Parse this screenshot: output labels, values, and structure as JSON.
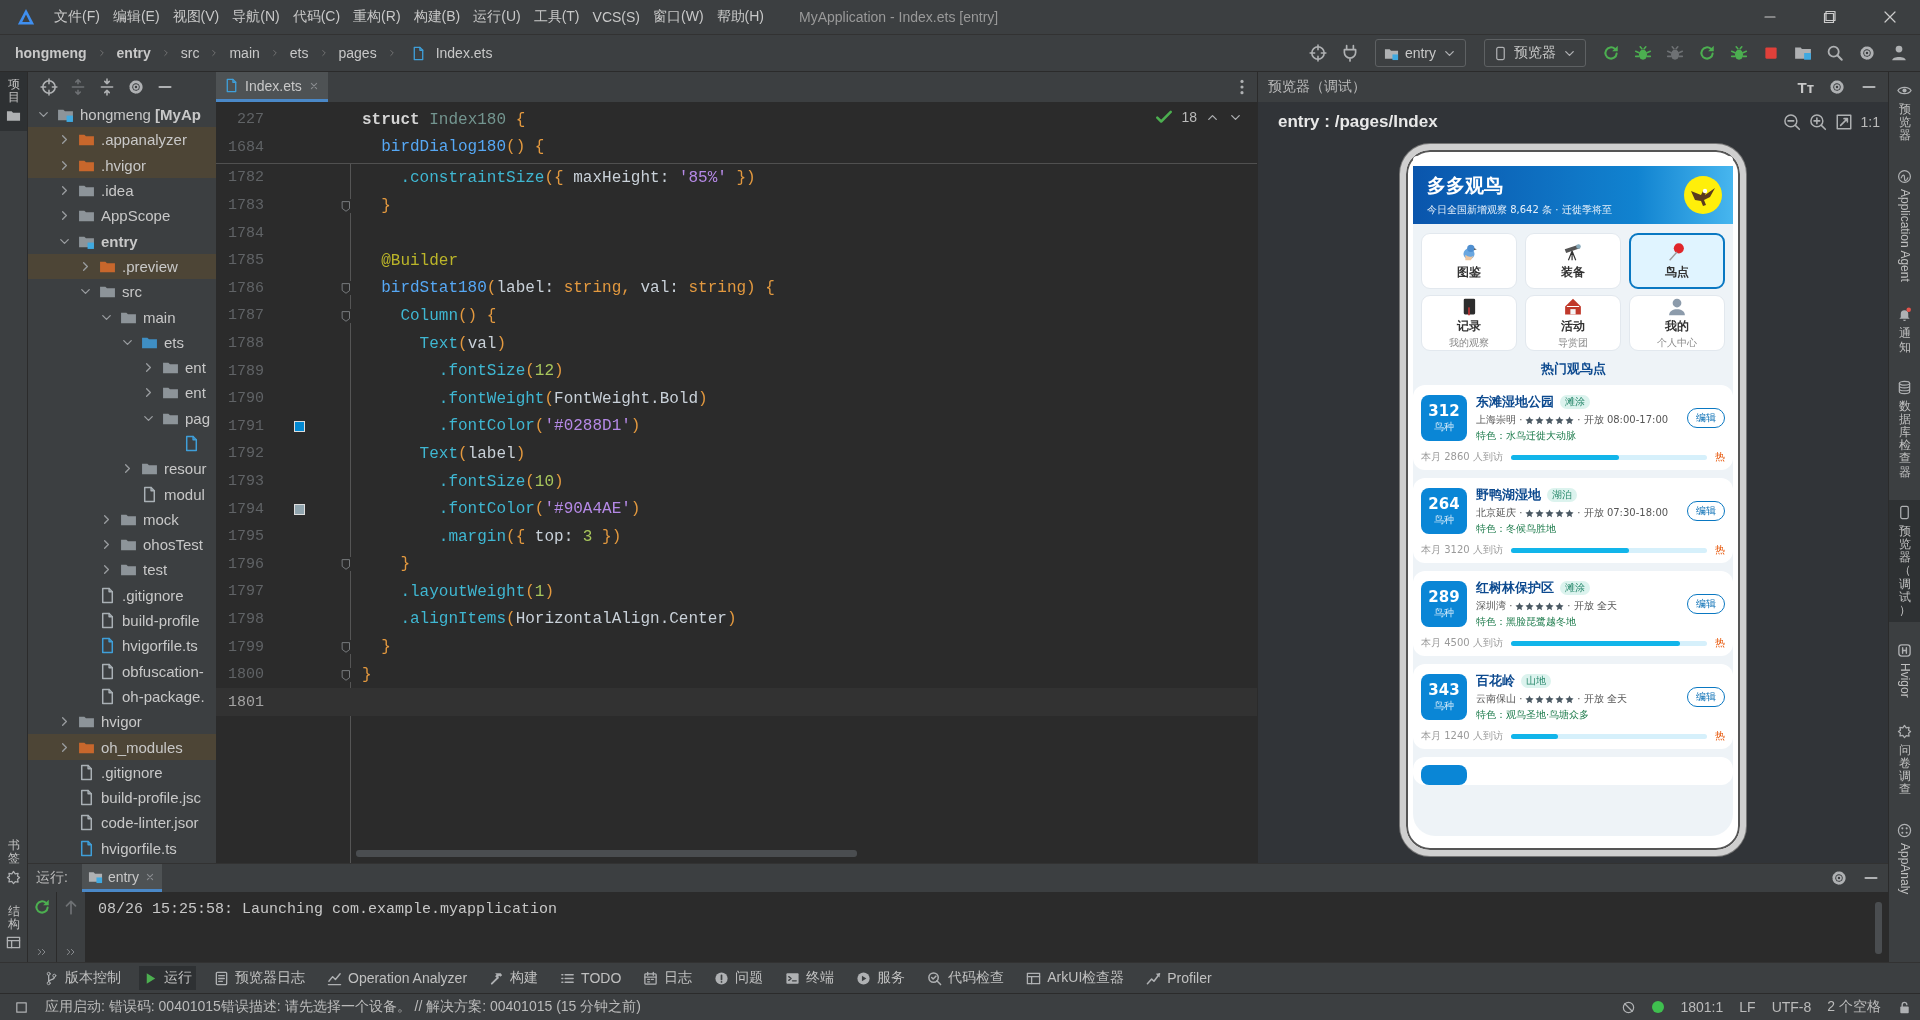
{
  "title_bar": {
    "menus": [
      "文件(F)",
      "编辑(E)",
      "视图(V)",
      "导航(N)",
      "代码(C)",
      "重构(R)",
      "构建(B)",
      "运行(U)",
      "工具(T)",
      "VCS(S)",
      "窗口(W)",
      "帮助(H)"
    ],
    "title": "MyApplication - Index.ets [entry]"
  },
  "nav_bar": {
    "breadcrumb": [
      "hongmeng",
      "entry",
      "src",
      "main",
      "ets",
      "pages",
      "Index.ets"
    ],
    "run_config": "entry",
    "device": "预览器"
  },
  "left_stripe": {
    "top": {
      "label": "项目",
      "selected": true
    },
    "bottom": [
      "书签",
      "结构"
    ]
  },
  "project_tree": [
    {
      "name": "hongmeng **[MyAp**",
      "kind": "module",
      "expanded": true,
      "children": [
        {
          "name": ".appanalyzer",
          "kind": "excluded",
          "expanded": false
        },
        {
          "name": ".hvigor",
          "kind": "excluded",
          "expanded": false
        },
        {
          "name": ".idea",
          "kind": "folder",
          "expanded": false
        },
        {
          "name": "AppScope",
          "kind": "folder",
          "expanded": false
        },
        {
          "name": "**entry**",
          "kind": "module",
          "expanded": true,
          "children": [
            {
              "name": ".preview",
              "kind": "excluded",
              "expanded": false
            },
            {
              "name": "src",
              "kind": "folder",
              "expanded": true,
              "children": [
                {
                  "name": "main",
                  "kind": "folder",
                  "expanded": true,
                  "children": [
                    {
                      "name": "ets",
                      "kind": "source",
                      "expanded": true,
                      "children": [
                        {
                          "name": "ent",
                          "kind": "folder",
                          "expanded": false
                        },
                        {
                          "name": "ent",
                          "kind": "folder",
                          "expanded": false
                        },
                        {
                          "name": "pag",
                          "kind": "folder",
                          "expanded": true,
                          "children": [
                            {
                              "kind": "ets"
                            }
                          ]
                        }
                      ]
                    },
                    {
                      "name": "resour",
                      "kind": "folder",
                      "expanded": false
                    },
                    {
                      "name": "modul",
                      "kind": "config"
                    }
                  ]
                },
                {
                  "name": "mock",
                  "kind": "folder",
                  "expanded": false
                },
                {
                  "name": "ohosTest",
                  "kind": "folder",
                  "expanded": false
                },
                {
                  "name": "test",
                  "kind": "folder",
                  "expanded": false
                }
              ]
            },
            {
              "name": ".gitignore",
              "kind": "file"
            },
            {
              "name": "build-profile",
              "kind": "config"
            },
            {
              "name": "hvigorfile.ts",
              "kind": "ts"
            },
            {
              "name": "obfuscation-",
              "kind": "file"
            },
            {
              "name": "oh-package.",
              "kind": "config"
            }
          ]
        },
        {
          "name": "hvigor",
          "kind": "folder",
          "expanded": false
        },
        {
          "name": "oh_modules",
          "kind": "excluded",
          "expanded": false
        },
        {
          "name": ".gitignore",
          "kind": "file"
        },
        {
          "name": "build-profile.jsc",
          "kind": "config"
        },
        {
          "name": "code-linter.jsor",
          "kind": "config"
        },
        {
          "name": "hvigorfile.ts",
          "kind": "ts"
        }
      ]
    }
  ],
  "editor": {
    "tab": {
      "label": "Index.ets",
      "selected": true
    },
    "inspection_count": "18",
    "sticky_lines": [
      {
        "number": "227",
        "tokens": [
          {
            "kind": "kw",
            "text": "struct "
          },
          {
            "kind": "type",
            "text": "Index180 "
          },
          {
            "kind": "punct",
            "text": "{"
          }
        ]
      },
      {
        "number": "1684",
        "tokens": [
          {
            "kind": "fn",
            "text": "  birdDialog180"
          },
          {
            "kind": "punct",
            "text": "() {"
          }
        ]
      }
    ],
    "lines": [
      {
        "number": "1782",
        "current": false,
        "fold": false,
        "tokens": [
          {
            "kind": "method",
            "text": "    .constraintSize"
          },
          {
            "kind": "punct",
            "text": "({"
          },
          {
            "kind": "plain",
            "text": " maxHeight: "
          },
          {
            "kind": "str",
            "text": "'85%'"
          },
          {
            "kind": "punct",
            "text": " })"
          }
        ]
      },
      {
        "number": "1783",
        "current": false,
        "fold": true,
        "tokens": [
          {
            "kind": "punct",
            "text": "  }"
          }
        ]
      },
      {
        "number": "1784",
        "current": false,
        "fold": false
      },
      {
        "number": "1785",
        "current": false,
        "fold": false,
        "tokens": [
          {
            "kind": "deco",
            "text": "  @Builder"
          }
        ]
      },
      {
        "number": "1786",
        "current": false,
        "fold": true,
        "tokens": [
          {
            "kind": "fn",
            "text": "  birdStat180"
          },
          {
            "kind": "punct",
            "text": "("
          },
          {
            "kind": "plain",
            "text": "label: "
          },
          {
            "kind": "ty",
            "text": "string"
          },
          {
            "kind": "punct",
            "text": ","
          },
          {
            "kind": "plain",
            "text": " val: "
          },
          {
            "kind": "ty",
            "text": "string"
          },
          {
            "kind": "punct",
            "text": ") {"
          }
        ]
      },
      {
        "number": "1787",
        "current": false,
        "fold": true,
        "tokens": [
          {
            "kind": "comp",
            "text": "    Column"
          },
          {
            "kind": "punct",
            "text": "() {"
          }
        ]
      },
      {
        "number": "1788",
        "current": false,
        "fold": false,
        "tokens": [
          {
            "kind": "comp",
            "text": "      Text"
          },
          {
            "kind": "punct",
            "text": "("
          },
          {
            "kind": "plain",
            "text": "val"
          },
          {
            "kind": "punct",
            "text": ")"
          }
        ]
      },
      {
        "number": "1789",
        "current": false,
        "fold": false,
        "tokens": [
          {
            "kind": "method",
            "text": "        .fontSize"
          },
          {
            "kind": "punct",
            "text": "("
          },
          {
            "kind": "num",
            "text": "12"
          },
          {
            "kind": "punct",
            "text": ")"
          }
        ]
      },
      {
        "number": "1790",
        "current": false,
        "fold": false,
        "tokens": [
          {
            "kind": "method",
            "text": "        .fontWeight"
          },
          {
            "kind": "punct",
            "text": "("
          },
          {
            "kind": "plain",
            "text": "FontWeight.Bold"
          },
          {
            "kind": "punct",
            "text": ")"
          }
        ]
      },
      {
        "number": "1791",
        "current": false,
        "fold": false,
        "color": "#0288d1",
        "tokens": [
          {
            "kind": "method",
            "text": "        .fontColor"
          },
          {
            "kind": "punct",
            "text": "("
          },
          {
            "kind": "str",
            "text": "'#0288D1'"
          },
          {
            "kind": "punct",
            "text": ")"
          }
        ]
      },
      {
        "number": "1792",
        "current": false,
        "fold": false,
        "tokens": [
          {
            "kind": "comp",
            "text": "      Text"
          },
          {
            "kind": "punct",
            "text": "("
          },
          {
            "kind": "plain",
            "text": "label"
          },
          {
            "kind": "punct",
            "text": ")"
          }
        ]
      },
      {
        "number": "1793",
        "current": false,
        "fold": false,
        "tokens": [
          {
            "kind": "method",
            "text": "        .fontSize"
          },
          {
            "kind": "punct",
            "text": "("
          },
          {
            "kind": "num",
            "text": "10"
          },
          {
            "kind": "punct",
            "text": ")"
          }
        ]
      },
      {
        "number": "1794",
        "current": false,
        "fold": false,
        "color": "#90a4ae",
        "tokens": [
          {
            "kind": "method",
            "text": "        .fontColor"
          },
          {
            "kind": "punct",
            "text": "("
          },
          {
            "kind": "str",
            "text": "'#90A4AE'"
          },
          {
            "kind": "punct",
            "text": ")"
          }
        ]
      },
      {
        "number": "1795",
        "current": false,
        "fold": false,
        "tokens": [
          {
            "kind": "method",
            "text": "        .margin"
          },
          {
            "kind": "punct",
            "text": "({"
          },
          {
            "kind": "plain",
            "text": " top: "
          },
          {
            "kind": "num",
            "text": "3"
          },
          {
            "kind": "punct",
            "text": " })"
          }
        ]
      },
      {
        "number": "1796",
        "current": false,
        "fold": true,
        "tokens": [
          {
            "kind": "punct",
            "text": "    }"
          }
        ]
      },
      {
        "number": "1797",
        "current": false,
        "fold": false,
        "tokens": [
          {
            "kind": "method",
            "text": "    .layoutWeight"
          },
          {
            "kind": "punct",
            "text": "("
          },
          {
            "kind": "num",
            "text": "1"
          },
          {
            "kind": "punct",
            "text": ")"
          }
        ]
      },
      {
        "number": "1798",
        "current": false,
        "fold": false,
        "tokens": [
          {
            "kind": "method",
            "text": "    .alignItems"
          },
          {
            "kind": "punct",
            "text": "("
          },
          {
            "kind": "plain",
            "text": "HorizontalAlign.Center"
          },
          {
            "kind": "punct",
            "text": ")"
          }
        ]
      },
      {
        "number": "1799",
        "current": false,
        "fold": true,
        "tokens": [
          {
            "kind": "punct",
            "text": "  }"
          }
        ]
      },
      {
        "number": "1800",
        "current": false,
        "fold": true,
        "tokens": [
          {
            "kind": "punct",
            "text": "}"
          }
        ]
      },
      {
        "number": "1801",
        "current": true,
        "fold": false
      }
    ]
  },
  "preview": {
    "title": "预览器（调试）",
    "font_icon": "Tт",
    "route": "entry : /pages/Index",
    "zoom_label": "1:1",
    "app": {
      "title": "多多观鸟",
      "subtitle": "今日全国新增观察 8,642 条 · 迁徙季将至",
      "tiles": [
        {
          "title": "图鉴",
          "selected": false
        },
        {
          "title": "装备",
          "selected": false
        },
        {
          "title": "鸟点",
          "selected": true
        },
        {
          "title": "记录",
          "subtitle": "我的观察",
          "selected": false
        },
        {
          "title": "活动",
          "subtitle": "导赏团",
          "selected": false
        },
        {
          "title": "我的",
          "subtitle": "个人中心",
          "selected": false
        }
      ],
      "section_title": "热门观鸟点",
      "spots": [
        {
          "count": "312",
          "count_label": "鸟种",
          "name": "东滩湿地公园",
          "tag": "滩涂",
          "location": "上海崇明 ·",
          "stars": 5,
          "hours": "· 开放 08:00-17:00",
          "feature": "特色：水鸟迁徙大动脉",
          "edit": "编辑",
          "visits": "本月 2860 人到访",
          "level": 0.55,
          "hot": "热"
        },
        {
          "count": "264",
          "count_label": "鸟种",
          "name": "野鸭湖湿地",
          "tag": "湖泊",
          "location": "北京延庆 ·",
          "stars": 5,
          "hours": "· 开放 07:30-18:00",
          "feature": "特色：冬候鸟胜地",
          "edit": "编辑",
          "visits": "本月 3120 人到访",
          "level": 0.6,
          "hot": "热"
        },
        {
          "count": "289",
          "count_label": "鸟种",
          "name": "红树林保护区",
          "tag": "滩涂",
          "location": "深圳湾 ·",
          "stars": 5,
          "hours": "· 开放 全天",
          "feature": "特色：黑脸琵鹭越冬地",
          "edit": "编辑",
          "visits": "本月 4500 人到访",
          "level": 0.86,
          "hot": "热"
        },
        {
          "count": "343",
          "count_label": "鸟种",
          "name": "百花岭",
          "tag": "山地",
          "location": "云南保山 ·",
          "stars": 5,
          "hours": "· 开放 全天",
          "feature": "特色：观鸟圣地·鸟塘众多",
          "edit": "编辑",
          "visits": "本月 1240 人到访",
          "level": 0.24,
          "hot": "热"
        }
      ]
    }
  },
  "right_stripe": [
    {
      "label": "预览器",
      "kind": "cjk",
      "selected": false
    },
    {
      "label": "Application Agent",
      "kind": "latin",
      "selected": false
    },
    {
      "label": "通知",
      "kind": "cjk",
      "selected": false
    },
    {
      "label": "数据库检查器",
      "kind": "cjk",
      "selected": false
    },
    {
      "label": "预览器（调试）",
      "kind": "cjk",
      "selected": true
    },
    {
      "label": "Hvigor",
      "kind": "latin",
      "selected": false
    },
    {
      "label": "问卷调查",
      "kind": "cjk",
      "selected": false
    },
    {
      "label": "AppAnaly",
      "kind": "latin",
      "selected": false
    }
  ],
  "run_panel": {
    "label": "运行:",
    "tab": "entry",
    "output": "08/26 15:25:58: Launching com.example.myapplication"
  },
  "tool_tabs": [
    {
      "label": "版本控制",
      "selected": false
    },
    {
      "label": "运行",
      "selected": true
    },
    {
      "label": "预览器日志",
      "selected": false
    },
    {
      "label": "Operation Analyzer",
      "selected": false
    },
    {
      "label": "构建",
      "selected": false
    },
    {
      "label": "TODO",
      "selected": false
    },
    {
      "label": "日志",
      "selected": false
    },
    {
      "label": "问题",
      "selected": false
    },
    {
      "label": "终端",
      "selected": false
    },
    {
      "label": "服务",
      "selected": false
    },
    {
      "label": "代码检查",
      "selected": false
    },
    {
      "label": "ArkUI检查器",
      "selected": false
    },
    {
      "label": "Profiler",
      "selected": false
    }
  ],
  "status_bar": {
    "message": "应用启动: 错误码: 00401015错误描述: 请先选择一个设备。 // 解决方案: 00401015 (15 分钟之前)",
    "position": "1801:1",
    "line_ending": "LF",
    "encoding": "UTF-8",
    "indent": "2 个空格"
  }
}
